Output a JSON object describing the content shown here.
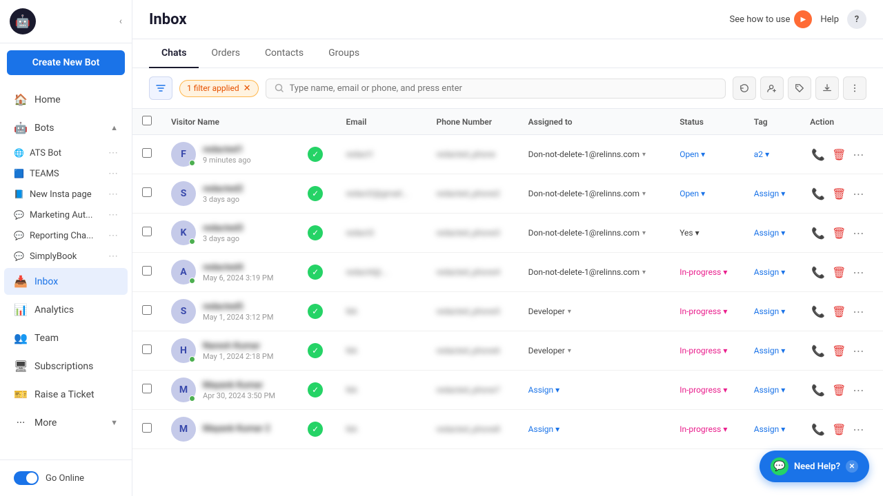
{
  "sidebar": {
    "logo": "🤖",
    "create_bot_label": "Create New Bot",
    "nav_items": [
      {
        "id": "home",
        "icon": "🏠",
        "label": "Home",
        "active": false
      },
      {
        "id": "bots",
        "icon": "🤖",
        "label": "Bots",
        "active": false
      },
      {
        "id": "inbox",
        "icon": "📥",
        "label": "Inbox",
        "active": true
      },
      {
        "id": "analytics",
        "icon": "📊",
        "label": "Analytics",
        "active": false
      },
      {
        "id": "team",
        "icon": "👥",
        "label": "Team",
        "active": false
      },
      {
        "id": "subscriptions",
        "icon": "🖥",
        "label": "Subscriptions",
        "active": false
      },
      {
        "id": "raise-ticket",
        "icon": "🎫",
        "label": "Raise a Ticket",
        "active": false
      },
      {
        "id": "more",
        "icon": "···",
        "label": "More",
        "active": false
      }
    ],
    "bots": [
      {
        "name": "ATS Bot",
        "icon": "🌐",
        "color": "#4285f4"
      },
      {
        "name": "TEAMS",
        "icon": "🟦",
        "color": "#7b68ee"
      },
      {
        "name": "New Insta page",
        "icon": "📘",
        "color": "#3b5998"
      },
      {
        "name": "Marketing Aut...",
        "icon": "💬",
        "color": "#25d366"
      },
      {
        "name": "Reporting Cha...",
        "icon": "💬",
        "color": "#25d366"
      },
      {
        "name": "SimplyBook",
        "icon": "💬",
        "color": "#25d366"
      }
    ],
    "go_online_label": "Go Online",
    "toggle_on": true
  },
  "header": {
    "title": "Inbox",
    "see_how_label": "See how to use",
    "help_label": "Help",
    "help_icon": "?"
  },
  "tabs": [
    {
      "id": "chats",
      "label": "Chats",
      "active": true
    },
    {
      "id": "orders",
      "label": "Orders",
      "active": false
    },
    {
      "id": "contacts",
      "label": "Contacts",
      "active": false
    },
    {
      "id": "groups",
      "label": "Groups",
      "active": false
    }
  ],
  "toolbar": {
    "filter_label": "1 filter applied",
    "search_placeholder": "Type name, email or phone, and press enter"
  },
  "table": {
    "columns": [
      "",
      "Visitor Name",
      "",
      "Email",
      "Phone Number",
      "Assigned to",
      "Status",
      "Tag",
      "Action"
    ],
    "rows": [
      {
        "initial": "F",
        "name": "redacted1",
        "time": "9 minutes ago",
        "online": true,
        "email": "redact1",
        "phone": "redacted_phone",
        "assigned": "Don-not-delete-1@relinns.com",
        "status": "Open",
        "status_type": "open",
        "tag": "a2",
        "tag_type": "value"
      },
      {
        "initial": "S",
        "name": "redacted2",
        "time": "3 days ago",
        "online": false,
        "email": "redact2@gmail...",
        "phone": "redacted_phone2",
        "assigned": "Don-not-delete-1@relinns.com",
        "status": "Open",
        "status_type": "open",
        "tag": "Assign",
        "tag_type": "assign"
      },
      {
        "initial": "K",
        "name": "redacted3",
        "time": "3 days ago",
        "online": true,
        "email": "redact3",
        "phone": "redacted_phone3",
        "assigned": "Don-not-delete-1@relinns.com",
        "status": "Yes",
        "status_type": "yes",
        "tag": "Assign",
        "tag_type": "assign"
      },
      {
        "initial": "A",
        "name": "redacted4",
        "time": "May 6, 2024 3:19 PM",
        "online": true,
        "email": "redact4@...",
        "phone": "redacted_phone4",
        "assigned": "Don-not-delete-1@relinns.com",
        "status": "In-progress",
        "status_type": "inprogress",
        "tag": "Assign",
        "tag_type": "assign"
      },
      {
        "initial": "S",
        "name": "redacted5",
        "time": "May 1, 2024 3:12 PM",
        "online": false,
        "email": "NA",
        "phone": "redacted_phone5",
        "assigned": "Developer",
        "status": "In-progress",
        "status_type": "inprogress",
        "tag": "Assign",
        "tag_type": "assign"
      },
      {
        "initial": "H",
        "name": "Naresh Kumar",
        "time": "May 1, 2024 2:18 PM",
        "online": true,
        "email": "NA",
        "phone": "redacted_phone6",
        "assigned": "Developer",
        "status": "In-progress",
        "status_type": "inprogress",
        "tag": "Assign",
        "tag_type": "assign"
      },
      {
        "initial": "M",
        "name": "Mayank Kumar",
        "time": "Apr 30, 2024 3:50 PM",
        "online": true,
        "email": "NA",
        "phone": "redacted_phone7",
        "assigned": "Assign",
        "assigned_type": "assign",
        "status": "In-progress",
        "status_type": "inprogress",
        "tag": "Assign",
        "tag_type": "assign"
      },
      {
        "initial": "M",
        "name": "Mayank Kumar 2",
        "time": "",
        "online": false,
        "email": "NA",
        "phone": "redacted_phone8",
        "assigned": "Assign",
        "assigned_type": "assign",
        "status": "In-progress",
        "status_type": "inprogress",
        "tag": "Assign",
        "tag_type": "assign"
      }
    ]
  },
  "help_widget": {
    "label": "Need Help?",
    "icon": "💬"
  }
}
